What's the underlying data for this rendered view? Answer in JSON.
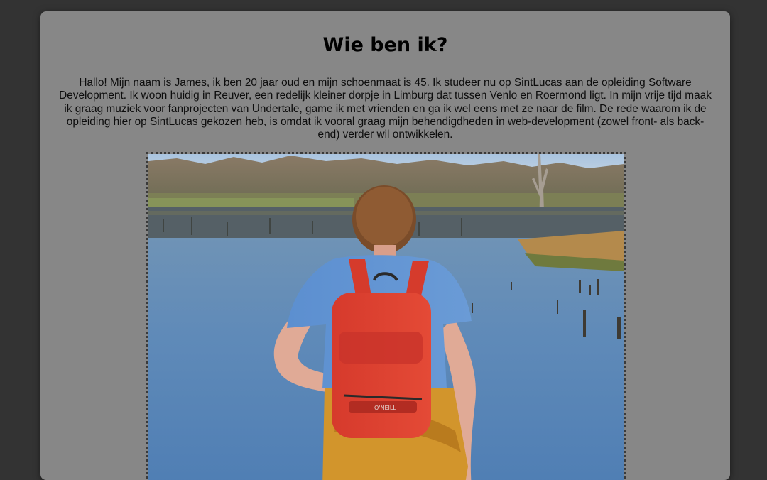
{
  "page": {
    "heading": "Wie ben ik?",
    "intro": "Hallo! Mijn naam is James, ik ben 20 jaar oud en mijn schoenmaat is 45. Ik studeer nu op SintLucas aan de opleiding Software Development. Ik woon huidig in Reuver, een redelijk kleiner dorpje in Limburg dat tussen Venlo en Roermond ligt. In mijn vrije tijd maak ik graag muziek voor fanprojecten van Undertale, game ik met vrienden en ga ik wel eens met ze naar de film. De rede waarom ik de opleiding hier op SintLucas gekozen heb, is omdat ik vooral graag mijn behendigdheden in web-development (zowel front- als back-end) verder wil ontwikkelen.",
    "photo_alt": "James bij het water",
    "backpack_brand": "O'NEILL"
  },
  "colors": {
    "page_bg": "#333333",
    "card_bg": "#878787",
    "frame_border": "#3a3a3a"
  }
}
